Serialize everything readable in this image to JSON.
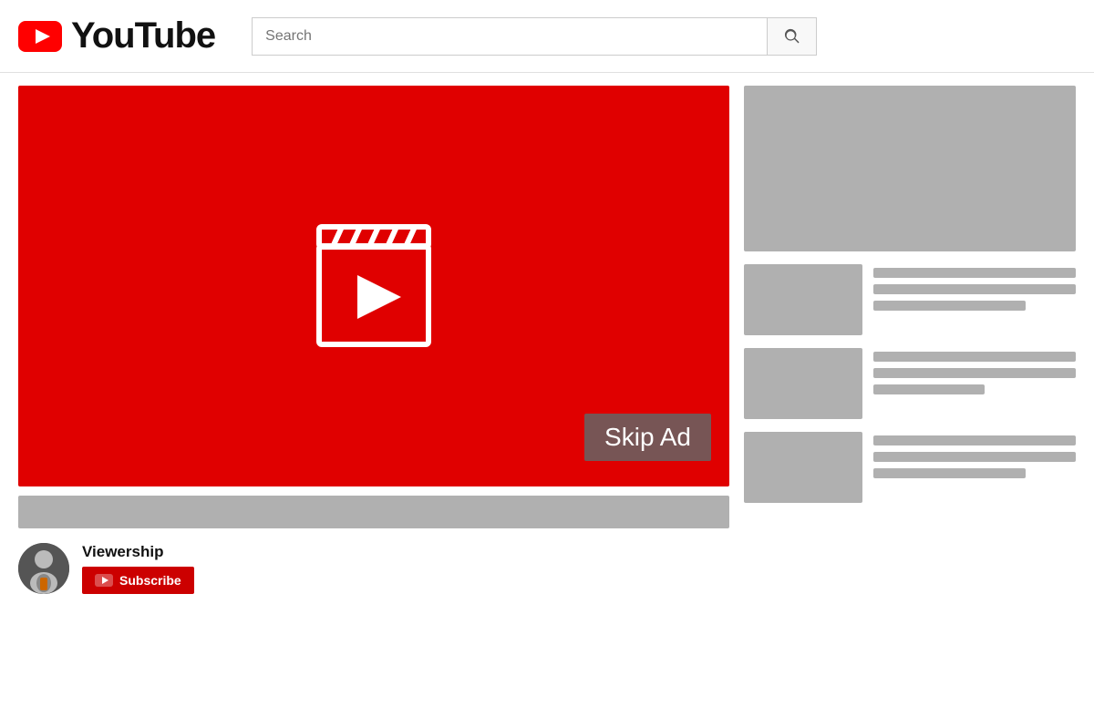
{
  "header": {
    "logo_text": "YouTube",
    "search_placeholder": "Search",
    "search_button_label": "Search"
  },
  "player": {
    "skip_ad_label": "Skip Ad"
  },
  "channel": {
    "name": "Viewership",
    "subscribe_label": "Subscribe"
  },
  "sidebar": {
    "items": [
      {
        "lines": [
          "full",
          "med",
          "short"
        ]
      },
      {
        "lines": [
          "full",
          "med",
          "short"
        ]
      },
      {
        "lines": [
          "full",
          "med",
          "short"
        ]
      }
    ]
  }
}
